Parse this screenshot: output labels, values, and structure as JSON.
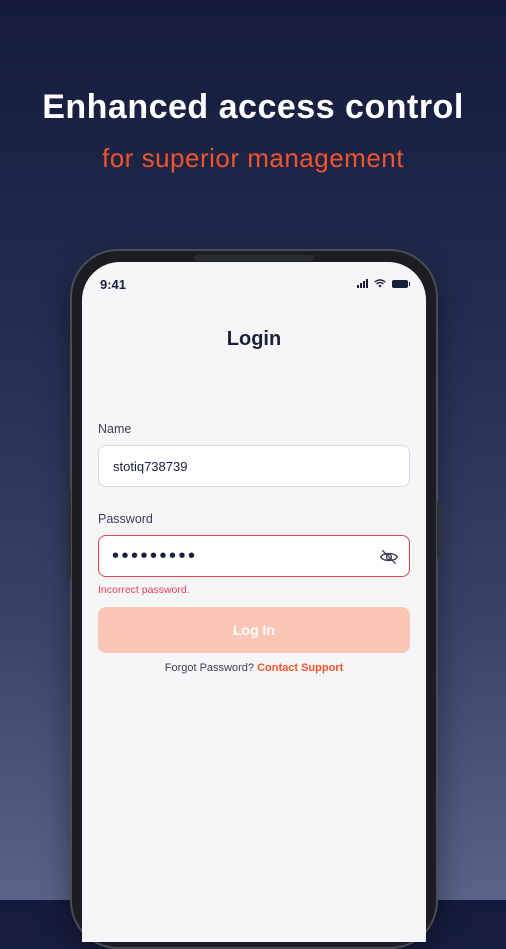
{
  "headline": "Enhanced access control",
  "subheadline": "for superior management",
  "status_bar": {
    "time": "9:41",
    "icons": [
      "signal-icon",
      "wifi-icon",
      "battery-icon"
    ]
  },
  "login": {
    "title": "Login",
    "name_label": "Name",
    "name_value": "stotiq738739",
    "password_label": "Password",
    "password_value": "•••••••••",
    "password_visibility_icon": "eye-off-icon",
    "error_text": "Incorrect password.",
    "button_label": "Log In",
    "forgot_text": "Forgot Password?",
    "support_link": "Contact Support"
  },
  "colors": {
    "accent": "#f2552c",
    "error": "#e0414e",
    "button_disabled": "#fcc6b7",
    "text_dark": "#1b1f3b"
  }
}
